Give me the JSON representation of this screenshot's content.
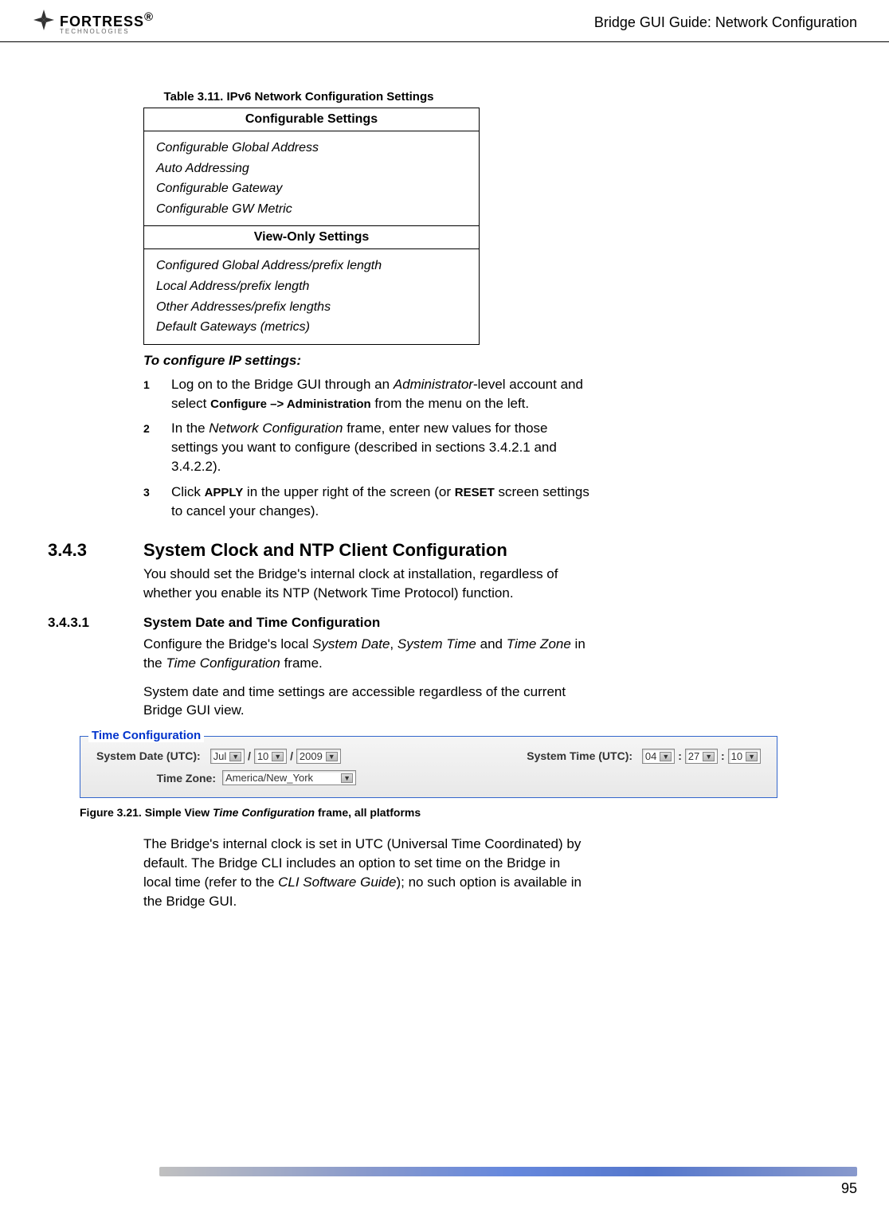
{
  "header": {
    "logo_main": "FORTRESS",
    "logo_sub": "TECHNOLOGIES",
    "logo_reg": "®",
    "title": "Bridge GUI Guide: Network Configuration"
  },
  "table311": {
    "caption": "Table 3.11. IPv6 Network Configuration Settings",
    "header1": "Configurable Settings",
    "items1": [
      "Configurable Global Address",
      "Auto Addressing",
      "Configurable Gateway",
      "Configurable GW Metric"
    ],
    "header2": "View-Only Settings",
    "items2": [
      "Configured Global Address/prefix length",
      "Local Address/prefix length",
      "Other Addresses/prefix lengths",
      "Default Gateways (metrics)"
    ]
  },
  "procedure": {
    "title": "To configure IP settings:",
    "step1_num": "1",
    "step1_a": "Log on to the Bridge GUI through an ",
    "step1_b": "Administrator",
    "step1_c": "-level account and select ",
    "step1_d": "Configure –> Administration",
    "step1_e": " from the menu on the left.",
    "step2_num": "2",
    "step2_a": "In the ",
    "step2_b": "Network Configuration",
    "step2_c": " frame, enter new values for those settings you want to configure (described in sections 3.4.2.1 and 3.4.2.2).",
    "step3_num": "3",
    "step3_a": "Click ",
    "step3_b": "APPLY",
    "step3_c": " in the upper right of the screen (or ",
    "step3_d": "RESET",
    "step3_e": " screen settings to cancel your changes)."
  },
  "section343": {
    "num": "3.4.3",
    "title": "System Clock and NTP Client Configuration",
    "body": "You should set the Bridge's internal clock at installation, regardless of whether you enable its NTP (Network Time Protocol) function."
  },
  "section3431": {
    "num": "3.4.3.1",
    "title": "System Date and Time Configuration",
    "body1_a": "Configure the Bridge's local ",
    "body1_b": "System Date",
    "body1_c": ", ",
    "body1_d": "System Time",
    "body1_e": " and ",
    "body1_f": "Time Zone",
    "body1_g": " in the ",
    "body1_h": "Time Configuration",
    "body1_i": " frame.",
    "body2": "System date and time settings are accessible regardless of the current Bridge GUI view."
  },
  "time_config": {
    "legend": "Time Configuration",
    "date_label": "System Date (UTC):",
    "month": "Jul",
    "day": "10",
    "year": "2009",
    "sep": "/",
    "time_label": "System Time (UTC):",
    "hour": "04",
    "min": "27",
    "sec": "10",
    "tsep": ":",
    "tz_label": "Time Zone:",
    "tz_value": "America/New_York"
  },
  "figure321": {
    "prefix": "Figure 3.21. Simple View ",
    "italic": "Time Configuration",
    "suffix": " frame, all platforms"
  },
  "final_para": {
    "a": "The Bridge's internal clock is set in UTC (Universal Time Coordinated) by default. The Bridge CLI includes an option to set time on the Bridge in local time (refer to the ",
    "b": "CLI Software Guide",
    "c": "); no such option is available in the Bridge GUI."
  },
  "page_num": "95"
}
